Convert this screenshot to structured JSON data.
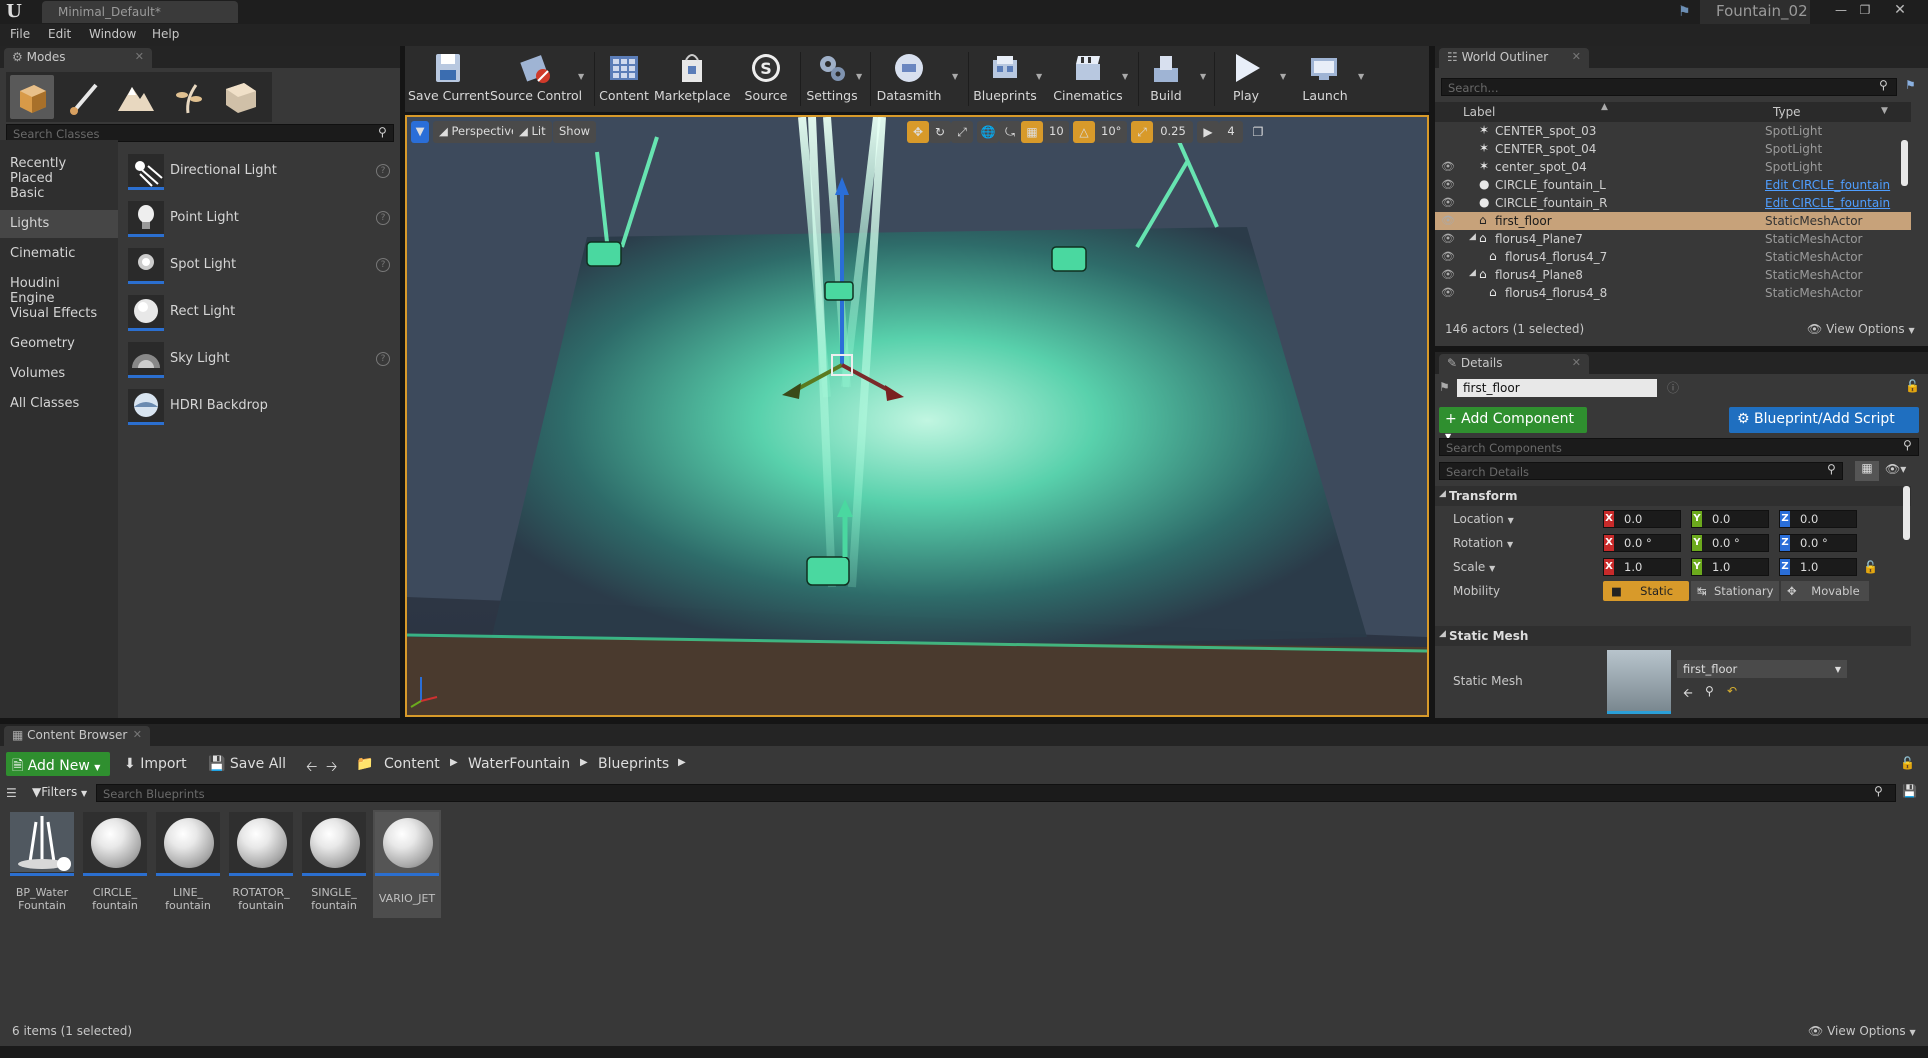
{
  "window": {
    "tab_title": "Minimal_Default*",
    "project_name": "Fountain_02"
  },
  "menu": [
    "File",
    "Edit",
    "Window",
    "Help"
  ],
  "modes": {
    "tab_label": "Modes",
    "mode_icons": [
      "place-mode-icon",
      "paint-mode-icon",
      "landscape-mode-icon",
      "foliage-mode-icon",
      "geometry-mode-icon"
    ],
    "search_placeholder": "Search Classes",
    "categories": [
      "Recently Placed",
      "Basic",
      "Lights",
      "Cinematic",
      "Houdini Engine",
      "Visual Effects",
      "Geometry",
      "Volumes",
      "All Classes"
    ],
    "selected_category": "Lights",
    "items": [
      {
        "label": "Directional Light",
        "icon": "directional-light-icon",
        "help": true
      },
      {
        "label": "Point Light",
        "icon": "point-light-icon",
        "help": true
      },
      {
        "label": "Spot Light",
        "icon": "spot-light-icon",
        "help": true
      },
      {
        "label": "Rect Light",
        "icon": "rect-light-icon",
        "help": false
      },
      {
        "label": "Sky Light",
        "icon": "sky-light-icon",
        "help": true
      },
      {
        "label": "HDRI Backdrop",
        "icon": "hdri-backdrop-icon",
        "help": false
      }
    ]
  },
  "toolbar": [
    {
      "label": "Save Current",
      "icon": "save-icon"
    },
    {
      "label": "Source Control",
      "icon": "source-control-icon"
    },
    {
      "label": "Content",
      "icon": "content-icon"
    },
    {
      "label": "Marketplace",
      "icon": "marketplace-icon"
    },
    {
      "label": "Source",
      "icon": "source-icon"
    },
    {
      "label": "Settings",
      "icon": "settings-icon"
    },
    {
      "label": "Datasmith",
      "icon": "datasmith-icon"
    },
    {
      "label": "Blueprints",
      "icon": "blueprints-icon"
    },
    {
      "label": "Cinematics",
      "icon": "cinematics-icon"
    },
    {
      "label": "Build",
      "icon": "build-icon"
    },
    {
      "label": "Play",
      "icon": "play-icon"
    },
    {
      "label": "Launch",
      "icon": "launch-icon"
    }
  ],
  "viewport": {
    "perspective_label": "Perspective",
    "lit_label": "Lit",
    "show_label": "Show",
    "grid_snap": "10",
    "rotation_snap": "10°",
    "scale_snap": "0.25",
    "camera_speed": "4"
  },
  "outliner": {
    "tab_label": "World Outliner",
    "search_placeholder": "Search...",
    "col_label": "Label",
    "col_type": "Type",
    "rows": [
      {
        "name": "CENTER_spot_03",
        "type": "SpotLight",
        "indent": 1,
        "link": false,
        "selected": false,
        "eye": false
      },
      {
        "name": "CENTER_spot_04",
        "type": "SpotLight",
        "indent": 1,
        "link": false,
        "selected": false,
        "eye": false
      },
      {
        "name": "center_spot_04",
        "type": "SpotLight",
        "indent": 1,
        "link": false,
        "selected": false,
        "eye": true
      },
      {
        "name": "CIRCLE_fountain_L",
        "type": "Edit CIRCLE_fountain",
        "indent": 1,
        "link": true,
        "selected": false,
        "eye": true
      },
      {
        "name": "CIRCLE_fountain_R",
        "type": "Edit CIRCLE_fountain",
        "indent": 1,
        "link": true,
        "selected": false,
        "eye": true
      },
      {
        "name": "first_floor",
        "type": "StaticMeshActor",
        "indent": 1,
        "link": false,
        "selected": true,
        "eye": true
      },
      {
        "name": "florus4_Plane7",
        "type": "StaticMeshActor",
        "indent": 0,
        "link": false,
        "selected": false,
        "eye": true
      },
      {
        "name": "florus4_florus4_7",
        "type": "StaticMeshActor",
        "indent": 2,
        "link": false,
        "selected": false,
        "eye": true
      },
      {
        "name": "florus4_Plane8",
        "type": "StaticMeshActor",
        "indent": 0,
        "link": false,
        "selected": false,
        "eye": true
      },
      {
        "name": "florus4_florus4_8",
        "type": "StaticMeshActor",
        "indent": 2,
        "link": false,
        "selected": false,
        "eye": true
      }
    ],
    "status": "146 actors (1 selected)",
    "view_options": "View Options"
  },
  "details": {
    "tab_label": "Details",
    "name_value": "first_floor",
    "add_component": "+ Add Component",
    "blueprint_script": "Blueprint/Add Script",
    "search_components": "Search Components",
    "search_details": "Search Details",
    "transform_header": "Transform",
    "location_label": "Location",
    "rotation_label": "Rotation",
    "scale_label": "Scale",
    "mobility_label": "Mobility",
    "location": [
      "0.0",
      "0.0",
      "0.0"
    ],
    "rotation": [
      "0.0 °",
      "0.0 °",
      "0.0 °"
    ],
    "scale": [
      "1.0",
      "1.0",
      "1.0"
    ],
    "mobility_options": [
      "Static",
      "Stationary",
      "Movable"
    ],
    "mobility_selected": "Static",
    "static_mesh_header": "Static Mesh",
    "static_mesh_label": "Static Mesh",
    "static_mesh_value": "first_floor"
  },
  "content_browser": {
    "tab_label": "Content Browser",
    "add_new": "Add New",
    "import": "Import",
    "save_all": "Save All",
    "path": [
      "Content",
      "WaterFountain",
      "Blueprints"
    ],
    "filters": "Filters",
    "search_placeholder": "Search Blueprints",
    "assets": [
      {
        "label": "BP_Water Fountain",
        "line1": "BP_Water",
        "line2": "Fountain",
        "selected": false,
        "kind": "fountain"
      },
      {
        "label": "CIRCLE_ fountain",
        "line1": "CIRCLE_",
        "line2": "fountain",
        "selected": false,
        "kind": "sphere"
      },
      {
        "label": "LINE_ fountain",
        "line1": "LINE_",
        "line2": "fountain",
        "selected": false,
        "kind": "sphere"
      },
      {
        "label": "ROTATOR_ fountain",
        "line1": "ROTATOR_",
        "line2": "fountain",
        "selected": false,
        "kind": "sphere"
      },
      {
        "label": "SINGLE_ fountain",
        "line1": "SINGLE_",
        "line2": "fountain",
        "selected": false,
        "kind": "sphere"
      },
      {
        "label": "VARIO_JET",
        "line1": "",
        "line2": "VARIO_JET",
        "selected": true,
        "kind": "sphere"
      }
    ],
    "status": "6 items (1 selected)",
    "view_options": "View Options"
  },
  "colors": {
    "accent_orange": "#d89a2a",
    "selection_tan": "#c7a27a",
    "add_green": "#2f8f2f",
    "blueprint_blue": "#1f6fc0",
    "fountain_teal": "#46e0b0"
  }
}
